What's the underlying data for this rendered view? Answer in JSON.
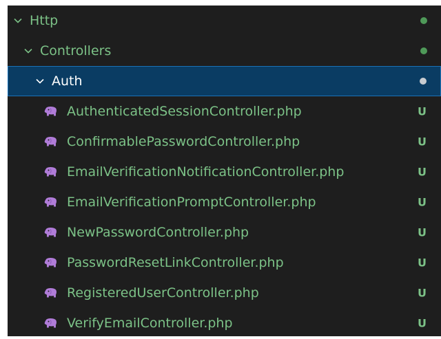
{
  "folders": [
    {
      "label": "Http",
      "depth": 0,
      "expanded": true,
      "selected": false
    },
    {
      "label": "Controllers",
      "depth": 1,
      "expanded": true,
      "selected": false
    },
    {
      "label": "Auth",
      "depth": 2,
      "expanded": true,
      "selected": true
    }
  ],
  "files": [
    {
      "label": "AuthenticatedSessionController.php",
      "status": "U"
    },
    {
      "label": "ConfirmablePasswordController.php",
      "status": "U"
    },
    {
      "label": "EmailVerificationNotificationController.php",
      "status": "U"
    },
    {
      "label": "EmailVerificationPromptController.php",
      "status": "U"
    },
    {
      "label": "NewPasswordController.php",
      "status": "U"
    },
    {
      "label": "PasswordResetLinkController.php",
      "status": "U"
    },
    {
      "label": "RegisteredUserController.php",
      "status": "U"
    },
    {
      "label": "VerifyEmailController.php",
      "status": "U"
    }
  ],
  "colors": {
    "background": "#1e1e1e",
    "untracked_text": "#7cc287",
    "selection_bg": "#0a3c63",
    "selection_border": "#1a72b8",
    "php_icon": "#b07cd8"
  },
  "icons": {
    "folder_toggle": "chevron-down-icon",
    "file": "php-elephant-icon"
  }
}
